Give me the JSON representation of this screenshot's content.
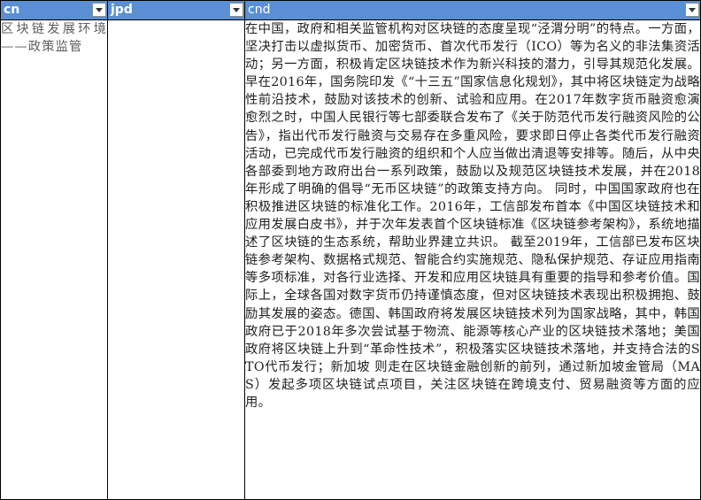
{
  "sheet": {
    "columns": [
      {
        "header": "cn"
      },
      {
        "header": "jpd"
      },
      {
        "header": "cnd"
      }
    ],
    "row": {
      "cn": "区块链发展环境——政策监管",
      "jpd": "",
      "cnd": "在中国，政府和相关监管机构对区块链的态度呈现“泾渭分明”的特点。一方面，坚决打击以虚拟货币、加密货币、首次代币发行（ICO）等为名义的非法集资活动；另一方面，积极肯定区块链技术作为新兴科技的潜力，引导其规范化发展。早在2016年，国务院印发《“十三五”国家信息化规划》，其中将区块链定为战略性前沿技术，鼓励对该技术的创新、试验和应用。在2017年数字货币融资愈演愈烈之时，中国人民银行等七部委联合发布了《关于防范代币发行融资风险的公告》，指出代币发行融资与交易存在多重风险，要求即日停止各类代币发行融资活动，已完成代币发行融资的组织和个人应当做出清退等安排等。随后，从中央各部委到地方政府出台一系列政策，鼓励以及规范区块链技术发展，并在2018年形成了明确的倡导“无币区块链”的政策支持方向。 同时，中国国家政府也在积极推进区块链的标准化工作。2016年，工信部发布首本《中国区块链技术和应用发展白皮书》，并于次年发表首个区块链标准《区块链参考架构》，系统地描述了区块链的生态系统，帮助业界建立共识。 截至2019年，工信部已发布区块链参考架构、数据格式规范、智能合约实施规范、隐私保护规范、存证应用指南等多项标准，对各行业选择、开发和应用区块链具有重要的指导和参考价值。国际上，全球各国对数字货币仍持谨慎态度，但对区块链技术表现出积极拥抱、鼓励其发展的姿态。德国、韩国政府将发展区块链技术列为国家战略，其中，韩国政府已于2018年多次尝试基于物流、能源等核心产业的区块链技术落地；美国政府将区块链上升到“革命性技术”，积极落实区块链技术落地，并支持合法的STO代币发行；新加坡 则走在区块链金融创新的前列，通过新加坡金管局（MAS）发起多项区块链试点项目，关注区块链在跨境支付、贸易融资等方面的应用。"
    },
    "filter_icon": "filter-dropdown-arrow-icon",
    "colors": {
      "header_bg": "#5b8fd4",
      "header_text": "#ffffff",
      "border": "#000000",
      "cell_text": "#1f1f1f",
      "cn_text": "#5e5e5e"
    }
  }
}
